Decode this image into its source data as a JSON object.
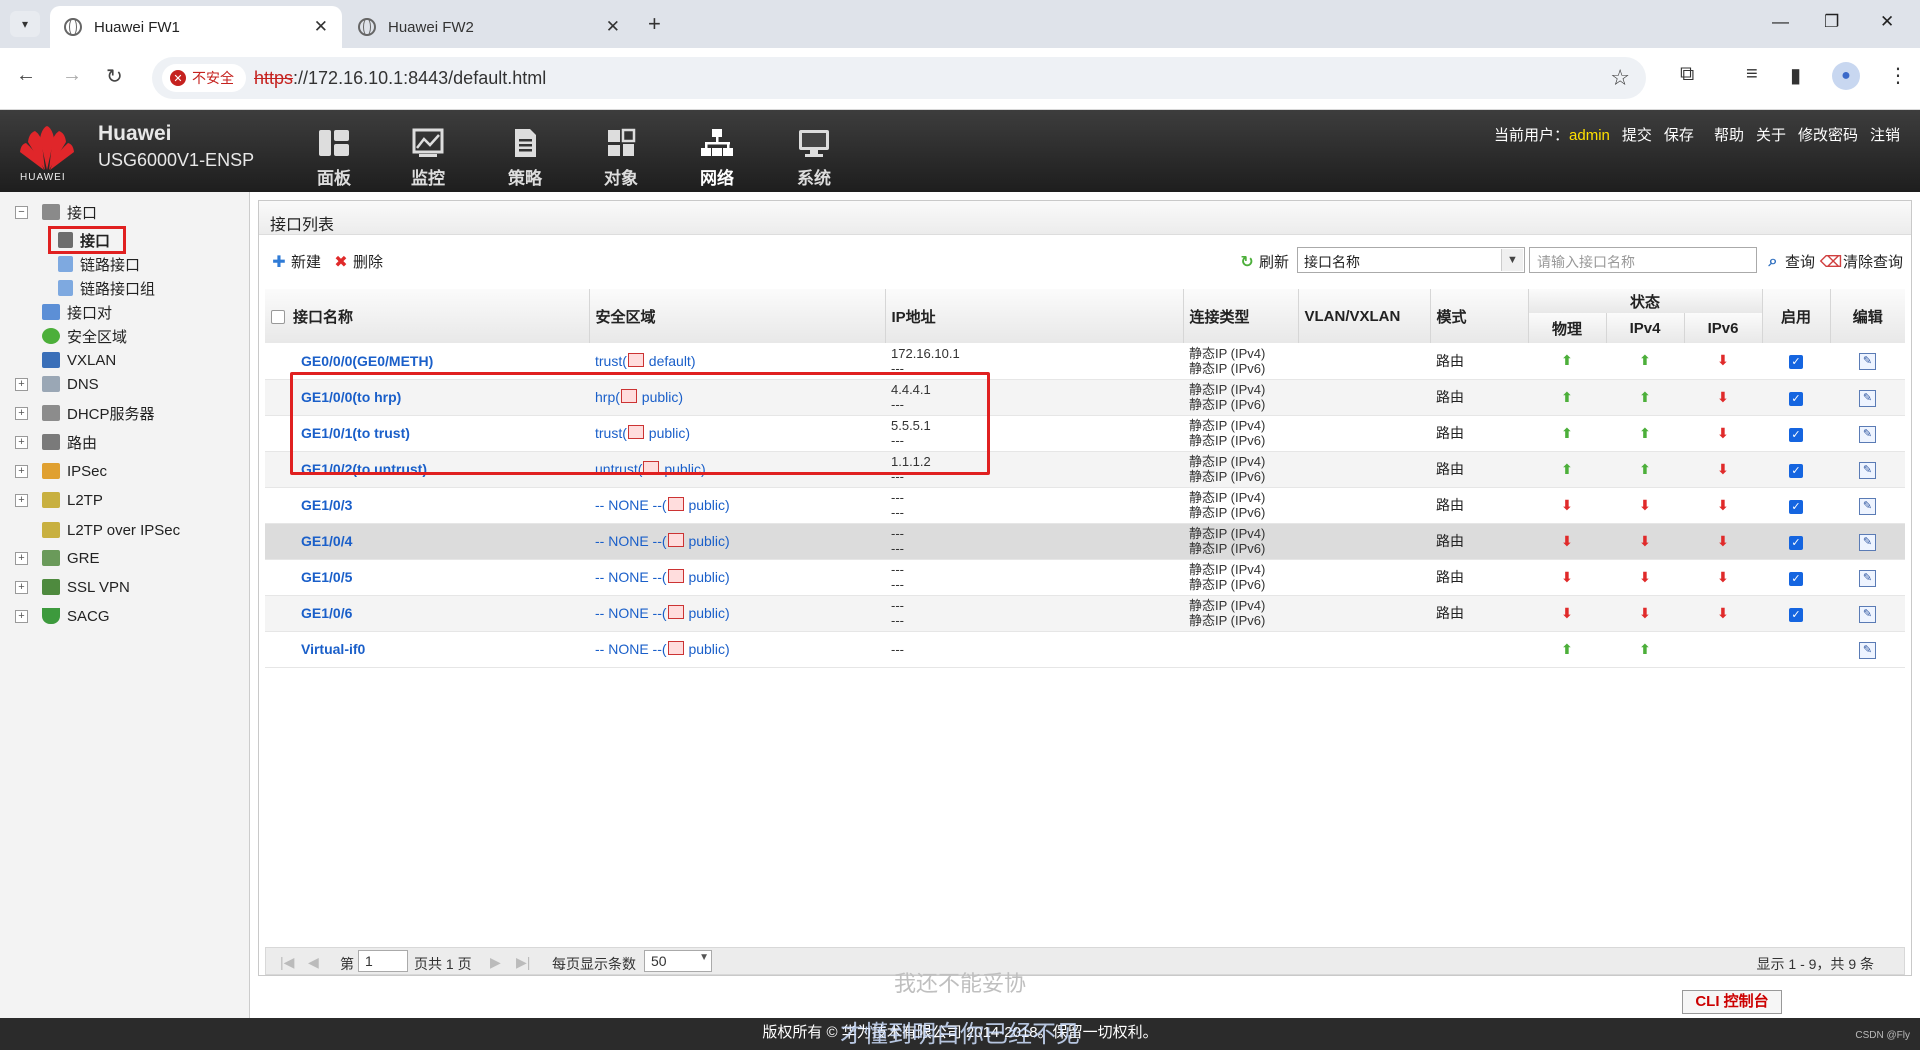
{
  "browser": {
    "tabs": [
      {
        "title": "Huawei FW1",
        "active": true
      },
      {
        "title": "Huawei FW2",
        "active": false
      }
    ],
    "security_label": "不安全",
    "url_scheme": "https",
    "url_rest": "://172.16.10.1:8443/default.html"
  },
  "header": {
    "brand": "Huawei",
    "model": "USG6000V1-ENSP",
    "logo_text": "HUAWEI",
    "nav": [
      {
        "label": "面板",
        "icon": "dashboard-icon"
      },
      {
        "label": "监控",
        "icon": "monitor-icon"
      },
      {
        "label": "策略",
        "icon": "policy-icon"
      },
      {
        "label": "对象",
        "icon": "object-icon"
      },
      {
        "label": "网络",
        "icon": "network-icon",
        "selected": true
      },
      {
        "label": "系统",
        "icon": "system-icon"
      }
    ],
    "current_user_label": "当前用户：",
    "user": "admin",
    "actions": [
      "提交",
      "保存",
      "帮助",
      "关于",
      "修改密码",
      "注销"
    ]
  },
  "sidebar": {
    "items": [
      {
        "label": "接口",
        "expand": "−"
      },
      {
        "label": "接口"
      },
      {
        "label": "链路接口"
      },
      {
        "label": "链路接口组"
      },
      {
        "label": "接口对"
      },
      {
        "label": "安全区域"
      },
      {
        "label": "VXLAN"
      },
      {
        "label": "DNS",
        "expand": "+"
      },
      {
        "label": "DHCP服务器",
        "expand": "+"
      },
      {
        "label": "路由",
        "expand": "+"
      },
      {
        "label": "IPSec",
        "expand": "+"
      },
      {
        "label": "L2TP",
        "expand": "+"
      },
      {
        "label": "L2TP over IPSec"
      },
      {
        "label": "GRE",
        "expand": "+"
      },
      {
        "label": "SSL VPN",
        "expand": "+"
      },
      {
        "label": "SACG",
        "expand": "+"
      }
    ]
  },
  "panel": {
    "title": "接口列表",
    "toolbar": {
      "new": "新建",
      "delete": "删除",
      "refresh": "刷新",
      "filter_select": "接口名称",
      "search_placeholder": "请输入接口名称",
      "query": "查询",
      "clear": "清除查询"
    },
    "columns": {
      "name": "接口名称",
      "zone": "安全区域",
      "ip": "IP地址",
      "conn": "连接类型",
      "vlan": "VLAN/VXLAN",
      "mode": "模式",
      "status": "状态",
      "physical": "物理",
      "ipv4": "IPv4",
      "ipv6": "IPv6",
      "enable": "启用",
      "edit": "编辑"
    },
    "rows": [
      {
        "name": "GE0/0/0(GE0/METH)",
        "zone_prefix": "trust(",
        "zone_suffix": "default)",
        "ip1": "172.16.10.1",
        "ip2": "---",
        "c1": "静态IP (IPv4)",
        "c2": "静态IP (IPv6)",
        "mode": "路由",
        "phy": "up",
        "v4": "up",
        "v6": "down",
        "enabled": true
      },
      {
        "name": "GE1/0/0(to hrp)",
        "zone_prefix": "hrp(",
        "zone_suffix": "public)",
        "ip1": "4.4.4.1",
        "ip2": "---",
        "c1": "静态IP (IPv4)",
        "c2": "静态IP (IPv6)",
        "mode": "路由",
        "phy": "up",
        "v4": "up",
        "v6": "down",
        "enabled": true
      },
      {
        "name": "GE1/0/1(to trust)",
        "zone_prefix": "trust(",
        "zone_suffix": "public)",
        "ip1": "5.5.5.1",
        "ip2": "---",
        "c1": "静态IP (IPv4)",
        "c2": "静态IP (IPv6)",
        "mode": "路由",
        "phy": "up",
        "v4": "up",
        "v6": "down",
        "enabled": true
      },
      {
        "name": "GE1/0/2(to untrust)",
        "zone_prefix": "untrust(",
        "zone_suffix": "public)",
        "ip1": "1.1.1.2",
        "ip2": "---",
        "c1": "静态IP (IPv4)",
        "c2": "静态IP (IPv6)",
        "mode": "路由",
        "phy": "up",
        "v4": "up",
        "v6": "down",
        "enabled": true
      },
      {
        "name": "GE1/0/3",
        "zone_prefix": "-- NONE --(",
        "zone_suffix": "public)",
        "ip1": "---",
        "ip2": "---",
        "c1": "静态IP (IPv4)",
        "c2": "静态IP (IPv6)",
        "mode": "路由",
        "phy": "down",
        "v4": "down",
        "v6": "down",
        "enabled": true
      },
      {
        "name": "GE1/0/4",
        "zone_prefix": "-- NONE --(",
        "zone_suffix": "public)",
        "ip1": "---",
        "ip2": "---",
        "c1": "静态IP (IPv4)",
        "c2": "静态IP (IPv6)",
        "mode": "路由",
        "phy": "down",
        "v4": "down",
        "v6": "down",
        "enabled": true
      },
      {
        "name": "GE1/0/5",
        "zone_prefix": "-- NONE --(",
        "zone_suffix": "public)",
        "ip1": "---",
        "ip2": "---",
        "c1": "静态IP (IPv4)",
        "c2": "静态IP (IPv6)",
        "mode": "路由",
        "phy": "down",
        "v4": "down",
        "v6": "down",
        "enabled": true
      },
      {
        "name": "GE1/0/6",
        "zone_prefix": "-- NONE --(",
        "zone_suffix": "public)",
        "ip1": "---",
        "ip2": "---",
        "c1": "静态IP (IPv4)",
        "c2": "静态IP (IPv6)",
        "mode": "路由",
        "phy": "down",
        "v4": "down",
        "v6": "down",
        "enabled": true
      },
      {
        "name": "Virtual-if0",
        "zone_prefix": "-- NONE --(",
        "zone_suffix": "public)",
        "ip1": "---",
        "ip2": "",
        "c1": "",
        "c2": "",
        "mode": "",
        "phy": "up",
        "v4": "up",
        "v6": "",
        "enabled": false
      }
    ],
    "pager": {
      "page_prefix": "第",
      "page": "1",
      "page_total": "页共 1 页",
      "per_page_label": "每页显示条数",
      "per_page": "50",
      "summary": "显示 1 - 9，共 9 条"
    }
  },
  "cli_button": "CLI 控制台",
  "footer": {
    "copyright": "版权所有 © 华为技术有限公司 2014-2018。保留一切权利。",
    "caption_top": "我还不能妥协",
    "caption_bottom": "才懂到明白你已经不见",
    "watermark": "CSDN @Fly"
  },
  "colors": {
    "accent": "#1a5fc9",
    "up": "#4caf3a",
    "down": "#e02a2a",
    "highlight": "#e02020",
    "header": "#2a2a2a"
  }
}
